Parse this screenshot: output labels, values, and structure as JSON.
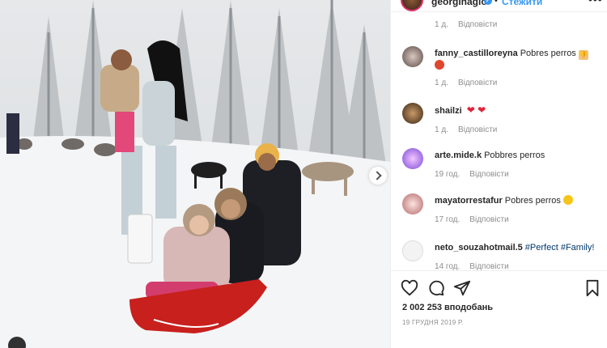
{
  "post": {
    "username": "georginagio",
    "follow_label": "Стежити",
    "separator": "•",
    "more_label": "•••",
    "likes_text": "2 002 253 вподобань",
    "date_text": "19 ГРУДНЯ 2019 Р."
  },
  "comments": [
    {
      "time": "1 д.",
      "reply": "Відповісти",
      "partial": true
    },
    {
      "user": "fanny_castilloreyna",
      "text": "Pobres perros",
      "emoji_after": "thumbs-down",
      "emoji_line2": "angry-face",
      "time": "1 д.",
      "reply": "Відповісти"
    },
    {
      "user": "shailzi",
      "text": "",
      "emoji_after": "two-red-hearts",
      "time": "1 д.",
      "reply": "Відповісти"
    },
    {
      "user": "arte.mide.k",
      "text": "Pobbres perros",
      "time": "19 год.",
      "reply": "Відповісти"
    },
    {
      "user": "mayatorrestafur",
      "text": "Pobres perros",
      "emoji_after": "sad-face",
      "time": "17 год.",
      "reply": "Відповісти"
    },
    {
      "user": "neto_souzahotmail.5",
      "tag1": "#Perfect",
      "tag2": "#Family!",
      "time": "14 год.",
      "reply": "Відповісти"
    }
  ],
  "icons": {
    "like": "heart-icon",
    "comment": "comment-icon",
    "share": "share-icon",
    "save": "bookmark-icon"
  },
  "colors": {
    "link": "#3897f0",
    "tag": "#00376b",
    "heart": "#ed4956",
    "muted": "#8e8e8e"
  }
}
